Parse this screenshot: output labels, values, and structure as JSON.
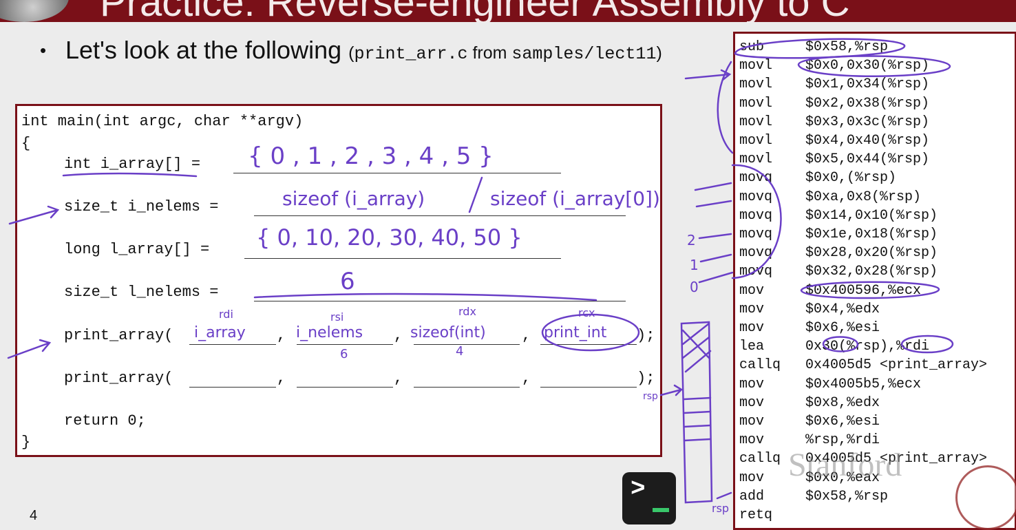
{
  "slide": {
    "title": "Practice: Reverse-engineer Assembly to C",
    "bullet": {
      "dot": "•",
      "lead": "Let's look at the following",
      "paren_open": "(",
      "file": "print_arr.c",
      "from": " from ",
      "dir": "samples/lect11",
      "paren_close": ")"
    },
    "number": "4"
  },
  "code": {
    "lines": [
      "int main(int argc, char **argv)",
      "{",
      "int i_array[] =",
      "size_t i_nelems =",
      "long l_array[] =",
      "size_t l_nelems =",
      "print_array(",
      "print_array(",
      "return 0;",
      "}"
    ],
    "comma": ",",
    "call_end": ");"
  },
  "handwriting": {
    "i_array": "{ 0 , 1 , 2 , 3 , 4 , 5 }",
    "i_nelems": "sizeof (i_array) / sizeof (i_array[0])",
    "l_array": "{ 0, 10, 20, 30, 40, 50 }",
    "l_nelems": "6",
    "arg1": "i_array",
    "arg2": "i_nelems",
    "arg3": "sizeof(int)",
    "arg4": "print_int",
    "reg1": "rdi",
    "reg2": "rsi",
    "reg3": "rdx",
    "reg4": "rcx",
    "val2": "6",
    "val3": "4",
    "idx2": "2",
    "idx1": "1",
    "idx0": "0",
    "sp": "rsp"
  },
  "assembly": [
    {
      "op": "sub",
      "arg": "$0x58,%rsp"
    },
    {
      "op": "movl",
      "arg": "$0x0,0x30(%rsp)"
    },
    {
      "op": "movl",
      "arg": "$0x1,0x34(%rsp)"
    },
    {
      "op": "movl",
      "arg": "$0x2,0x38(%rsp)"
    },
    {
      "op": "movl",
      "arg": "$0x3,0x3c(%rsp)"
    },
    {
      "op": "movl",
      "arg": "$0x4,0x40(%rsp)"
    },
    {
      "op": "movl",
      "arg": "$0x5,0x44(%rsp)"
    },
    {
      "op": "movq",
      "arg": "$0x0,(%rsp)"
    },
    {
      "op": "movq",
      "arg": "$0xa,0x8(%rsp)"
    },
    {
      "op": "movq",
      "arg": "$0x14,0x10(%rsp)"
    },
    {
      "op": "movq",
      "arg": "$0x1e,0x18(%rsp)"
    },
    {
      "op": "movq",
      "arg": "$0x28,0x20(%rsp)"
    },
    {
      "op": "movq",
      "arg": "$0x32,0x28(%rsp)"
    },
    {
      "op": "mov",
      "arg": "$0x400596,%ecx"
    },
    {
      "op": "mov",
      "arg": "$0x4,%edx"
    },
    {
      "op": "mov",
      "arg": "$0x6,%esi"
    },
    {
      "op": "lea",
      "arg": "0x30(%rsp),%rdi"
    },
    {
      "op": "callq",
      "arg": "0x4005d5 <print_array>"
    },
    {
      "op": "mov",
      "arg": "$0x4005b5,%ecx"
    },
    {
      "op": "mov",
      "arg": "$0x8,%edx"
    },
    {
      "op": "mov",
      "arg": "$0x6,%esi"
    },
    {
      "op": "mov",
      "arg": "%rsp,%rdi"
    },
    {
      "op": "callq",
      "arg": "0x4005d5 <print_array>"
    },
    {
      "op": "mov",
      "arg": "$0x0,%eax"
    },
    {
      "op": "add",
      "arg": "$0x58,%rsp"
    },
    {
      "op": "retq",
      "arg": ""
    }
  ],
  "terminal": {
    "prompt": ">"
  },
  "watermark": "Stanford",
  "colors": {
    "accent": "#7a1018",
    "ink": "#6a3fc7",
    "terminal_cursor": "#39c76a"
  }
}
